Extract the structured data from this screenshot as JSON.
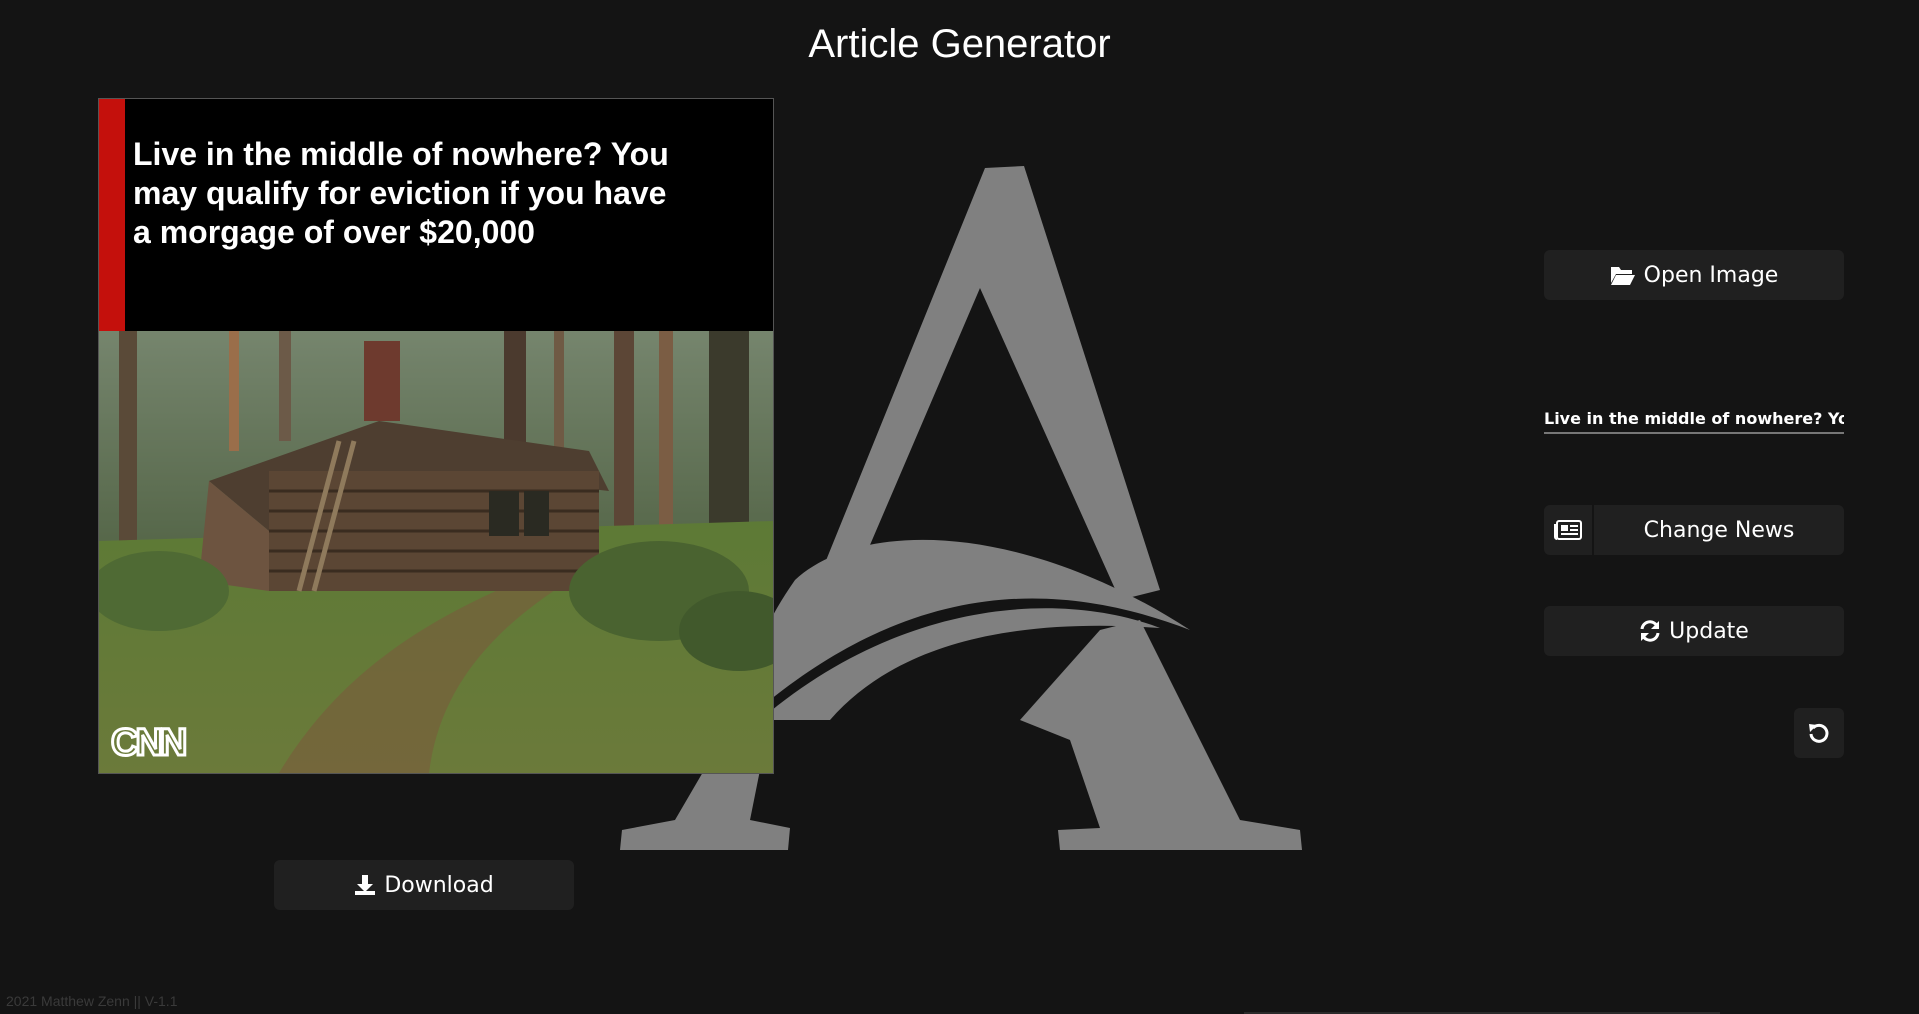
{
  "app": {
    "title": "Article Generator"
  },
  "article": {
    "headline": "Live in the middle of nowhere? You may qualify for eviction if you have a morgage of over $20,000",
    "accent_color": "#c4100c",
    "source_logo": "CNN",
    "image_subject": "log-cabin-in-forest"
  },
  "controls": {
    "open_image_label": "Open Image",
    "headline_value": "Live in the middle of nowhere? You may qualify for eviction if you have a morgage of over $20,000",
    "change_news_label": "Change News",
    "update_label": "Update",
    "download_label": "Download"
  },
  "icons": {
    "open_image": "folder-open-icon",
    "change_news": "newspaper-icon",
    "update": "refresh-icon",
    "download": "download-icon",
    "reset": "undo-icon"
  },
  "footer": {
    "text": "2021 Matthew Zenn || V-1.1"
  },
  "colors": {
    "background": "#141414",
    "button": "#202020",
    "logo": "#808080"
  }
}
